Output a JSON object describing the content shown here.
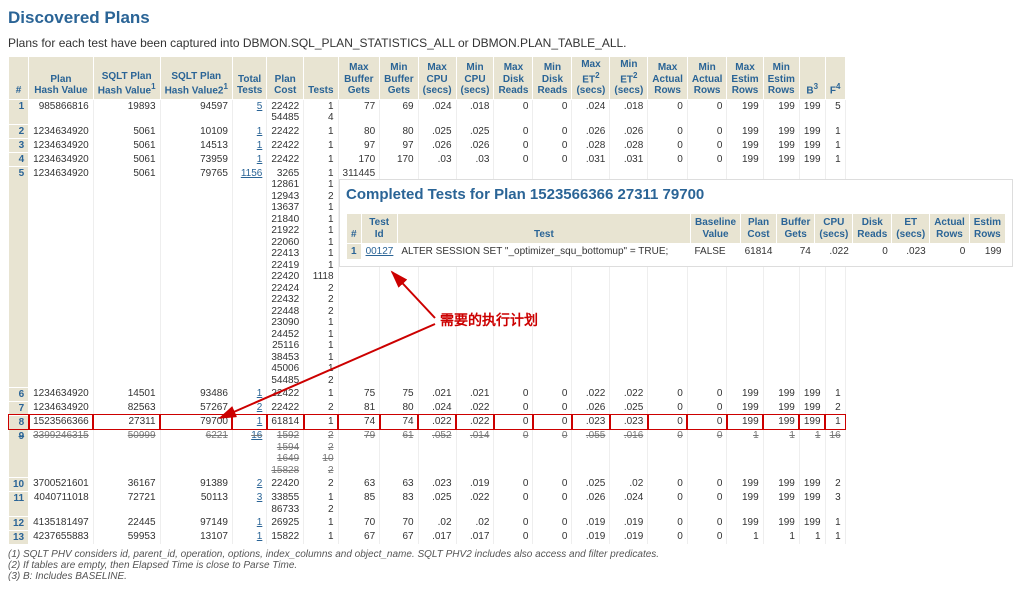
{
  "title": "Discovered Plans",
  "intro": "Plans for each test have been captured into DBMON.SQL_PLAN_STATISTICS_ALL or DBMON.PLAN_TABLE_ALL.",
  "cols": {
    "idx": "#",
    "phv": "Plan\nHash Value",
    "sqlt1": "SQLT Plan\nHash Value",
    "sqlt1_sup": "1",
    "sqlt2": "SQLT Plan\nHash Value2",
    "sqlt2_sup": "1",
    "total_tests": "Total\nTests",
    "plan_cost": "Plan\nCost",
    "tests": "Tests",
    "max_bg": "Max\nBuffer\nGets",
    "min_bg": "Min\nBuffer\nGets",
    "max_cpu": "Max\nCPU\n(secs)",
    "min_cpu": "Min\nCPU\n(secs)",
    "max_dr": "Max\nDisk\nReads",
    "min_dr": "Min\nDisk\nReads",
    "max_et": "Max\nET",
    "max_et_sup": "2",
    "max_et_unit": "(secs)",
    "min_et": "Min\nET",
    "min_et_sup": "2",
    "min_et_unit": "(secs)",
    "max_ar": "Max\nActual\nRows",
    "min_ar": "Min\nActual\nRows",
    "max_er": "Max\nEstim\nRows",
    "min_er": "Min\nEstim\nRows",
    "b": "B",
    "b_sup": "3",
    "f": "F",
    "f_sup": "4"
  },
  "rows": [
    {
      "n": "1",
      "phv": "985866816",
      "s1": "19893",
      "s2": "94597",
      "tt": "5",
      "pc": [
        "22422",
        "54485"
      ],
      "tests": [
        "1",
        "4"
      ],
      "maxbg": "77",
      "minbg": "69",
      "maxcpu": ".024",
      "mincpu": ".018",
      "maxdr": "0",
      "mindr": "0",
      "maxet": ".024",
      "minet": ".018",
      "maxar": "0",
      "minar": "0",
      "maxer": "199",
      "miner": "199",
      "b": "199",
      "f": "5"
    },
    {
      "n": "2",
      "phv": "1234634920",
      "s1": "5061",
      "s2": "10109",
      "tt": "1",
      "pc": [
        "22422"
      ],
      "tests": [
        "1"
      ],
      "maxbg": "80",
      "minbg": "80",
      "maxcpu": ".025",
      "mincpu": ".025",
      "maxdr": "0",
      "mindr": "0",
      "maxet": ".026",
      "minet": ".026",
      "maxar": "0",
      "minar": "0",
      "maxer": "199",
      "miner": "199",
      "b": "199",
      "f": "1"
    },
    {
      "n": "3",
      "phv": "1234634920",
      "s1": "5061",
      "s2": "14513",
      "tt": "1",
      "pc": [
        "22422"
      ],
      "tests": [
        "1"
      ],
      "maxbg": "97",
      "minbg": "97",
      "maxcpu": ".026",
      "mincpu": ".026",
      "maxdr": "0",
      "mindr": "0",
      "maxet": ".028",
      "minet": ".028",
      "maxar": "0",
      "minar": "0",
      "maxer": "199",
      "miner": "199",
      "b": "199",
      "f": "1"
    },
    {
      "n": "4",
      "phv": "1234634920",
      "s1": "5061",
      "s2": "73959",
      "tt": "1",
      "pc": [
        "22422"
      ],
      "tests": [
        "1"
      ],
      "maxbg": "170",
      "minbg": "170",
      "maxcpu": ".03",
      "mincpu": ".03",
      "maxdr": "0",
      "mindr": "0",
      "maxet": ".031",
      "minet": ".031",
      "maxar": "0",
      "minar": "0",
      "maxer": "199",
      "miner": "199",
      "b": "199",
      "f": "1"
    },
    {
      "n": "5",
      "phv": "1234634920",
      "s1": "5061",
      "s2": "79765",
      "tt": "1156",
      "pc": [
        "3265",
        "12861",
        "12943",
        "13637",
        "21840",
        "21922",
        "22060",
        "22413",
        "22419",
        "22420",
        "22424",
        "22432",
        "22448",
        "23090",
        "24452",
        "25116",
        "38453",
        "45006",
        "54485"
      ],
      "tests": [
        "1",
        "1",
        "2",
        "1",
        "1",
        "1",
        "1",
        "1",
        "1",
        "1118",
        "2",
        "2",
        "2",
        "1",
        "1",
        "1",
        "1",
        "1",
        "2"
      ],
      "maxbg": "311445"
    },
    {
      "n": "6",
      "phv": "1234634920",
      "s1": "14501",
      "s2": "93486",
      "tt": "1",
      "pc": [
        "22422"
      ],
      "tests": [
        "1"
      ],
      "maxbg": "75",
      "minbg": "75",
      "maxcpu": ".021",
      "mincpu": ".021",
      "maxdr": "0",
      "mindr": "0",
      "maxet": ".022",
      "minet": ".022",
      "maxar": "0",
      "minar": "0",
      "maxer": "199",
      "miner": "199",
      "b": "199",
      "f": "1"
    },
    {
      "n": "7",
      "phv": "1234634920",
      "s1": "82563",
      "s2": "57267",
      "tt": "2",
      "pc": [
        "22422"
      ],
      "tests": [
        "2"
      ],
      "maxbg": "81",
      "minbg": "80",
      "maxcpu": ".024",
      "mincpu": ".022",
      "maxdr": "0",
      "mindr": "0",
      "maxet": ".026",
      "minet": ".025",
      "maxar": "0",
      "minar": "0",
      "maxer": "199",
      "miner": "199",
      "b": "199",
      "f": "2"
    },
    {
      "n": "8",
      "phv": "1523566366",
      "s1": "27311",
      "s2": "79700",
      "tt": "1",
      "pc": [
        "61814"
      ],
      "tests": [
        "1"
      ],
      "maxbg": "74",
      "minbg": "74",
      "maxcpu": ".022",
      "mincpu": ".022",
      "maxdr": "0",
      "mindr": "0",
      "maxet": ".023",
      "minet": ".023",
      "maxar": "0",
      "minar": "0",
      "maxer": "199",
      "miner": "199",
      "b": "199",
      "f": "1",
      "highlight": true
    },
    {
      "n": "9",
      "phv": "3399246315",
      "s1": "50999",
      "s2": "6221",
      "tt": "16",
      "pc": [
        "1592",
        "1594",
        "1649",
        "15828"
      ],
      "tests": [
        "2",
        "2",
        "10",
        "2"
      ],
      "maxbg": "79",
      "minbg": "61",
      "maxcpu": ".052",
      "mincpu": ".014",
      "maxdr": "0",
      "mindr": "0",
      "maxet": ".055",
      "minet": ".016",
      "maxar": "0",
      "minar": "0",
      "maxer": "1",
      "miner": "1",
      "b": "1",
      "f": "16",
      "strike": true
    },
    {
      "n": "10",
      "phv": "3700521601",
      "s1": "36167",
      "s2": "91389",
      "tt": "2",
      "pc": [
        "22420"
      ],
      "tests": [
        "2"
      ],
      "maxbg": "63",
      "minbg": "63",
      "maxcpu": ".023",
      "mincpu": ".019",
      "maxdr": "0",
      "mindr": "0",
      "maxet": ".025",
      "minet": ".02",
      "maxar": "0",
      "minar": "0",
      "maxer": "199",
      "miner": "199",
      "b": "199",
      "f": "2"
    },
    {
      "n": "11",
      "phv": "4040711018",
      "s1": "72721",
      "s2": "50113",
      "tt": "3",
      "pc": [
        "33855",
        "86733"
      ],
      "tests": [
        "1",
        "2"
      ],
      "maxbg": "85",
      "minbg": "83",
      "maxcpu": ".025",
      "mincpu": ".022",
      "maxdr": "0",
      "mindr": "0",
      "maxet": ".026",
      "minet": ".024",
      "maxar": "0",
      "minar": "0",
      "maxer": "199",
      "miner": "199",
      "b": "199",
      "f": "3"
    },
    {
      "n": "12",
      "phv": "4135181497",
      "s1": "22445",
      "s2": "97149",
      "tt": "1",
      "pc": [
        "26925"
      ],
      "tests": [
        "1"
      ],
      "maxbg": "70",
      "minbg": "70",
      "maxcpu": ".02",
      "mincpu": ".02",
      "maxdr": "0",
      "mindr": "0",
      "maxet": ".019",
      "minet": ".019",
      "maxar": "0",
      "minar": "0",
      "maxer": "199",
      "miner": "199",
      "b": "199",
      "f": "1"
    },
    {
      "n": "13",
      "phv": "4237655883",
      "s1": "59953",
      "s2": "13107",
      "tt": "1",
      "pc": [
        "15822"
      ],
      "tests": [
        "1"
      ],
      "maxbg": "67",
      "minbg": "67",
      "maxcpu": ".017",
      "mincpu": ".017",
      "maxdr": "0",
      "mindr": "0",
      "maxet": ".019",
      "minet": ".019",
      "maxar": "0",
      "minar": "0",
      "maxer": "1",
      "miner": "1",
      "b": "1",
      "f": "1"
    }
  ],
  "footnotes": [
    "(1) SQLT PHV considers id, parent_id, operation, options, index_columns and object_name. SQLT PHV2 includes also access and filter predicates.",
    "(2) If tables are empty, then Elapsed Time is close to Parse Time.",
    "(3) B: Includes BASELINE."
  ],
  "popup": {
    "title": "Completed Tests for Plan 1523566366 27311 79700",
    "cols": {
      "idx": "#",
      "testid": "Test\nId",
      "test": "Test",
      "baseline": "Baseline\nValue",
      "plancost": "Plan\nCost",
      "bg": "Buffer\nGets",
      "cpu": "CPU\n(secs)",
      "dr": "Disk\nReads",
      "et": "ET\n(secs)",
      "ar": "Actual\nRows",
      "er": "Estim\nRows"
    },
    "row": {
      "idx": "1",
      "testid": "00127",
      "test": "ALTER SESSION SET \"_optimizer_squ_bottomup\" = TRUE;",
      "baseline": "FALSE",
      "plancost": "61814",
      "bg": "74",
      "cpu": ".022",
      "dr": "0",
      "et": ".023",
      "ar": "0",
      "er": "199"
    }
  },
  "annotation": "需要的执行计划"
}
